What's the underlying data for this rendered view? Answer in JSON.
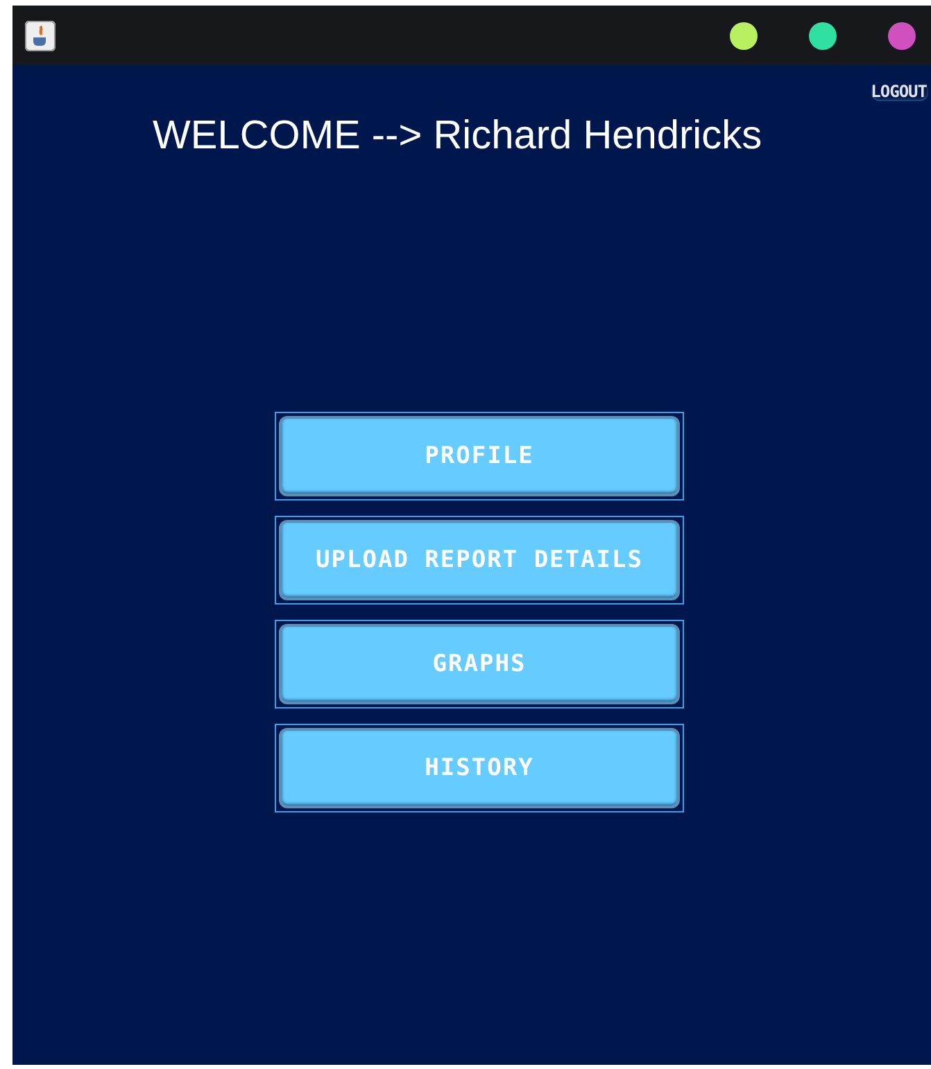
{
  "window": {
    "controls": [
      {
        "color": "#b8f060"
      },
      {
        "color": "#30e0a0"
      },
      {
        "color": "#d050c0"
      }
    ]
  },
  "logout": "LOGOUT",
  "welcome": "WELCOME --> Richard Hendricks",
  "menu": [
    {
      "label": "PROFILE"
    },
    {
      "label": "UPLOAD REPORT DETAILS"
    },
    {
      "label": "GRAPHS"
    },
    {
      "label": "HISTORY"
    }
  ]
}
